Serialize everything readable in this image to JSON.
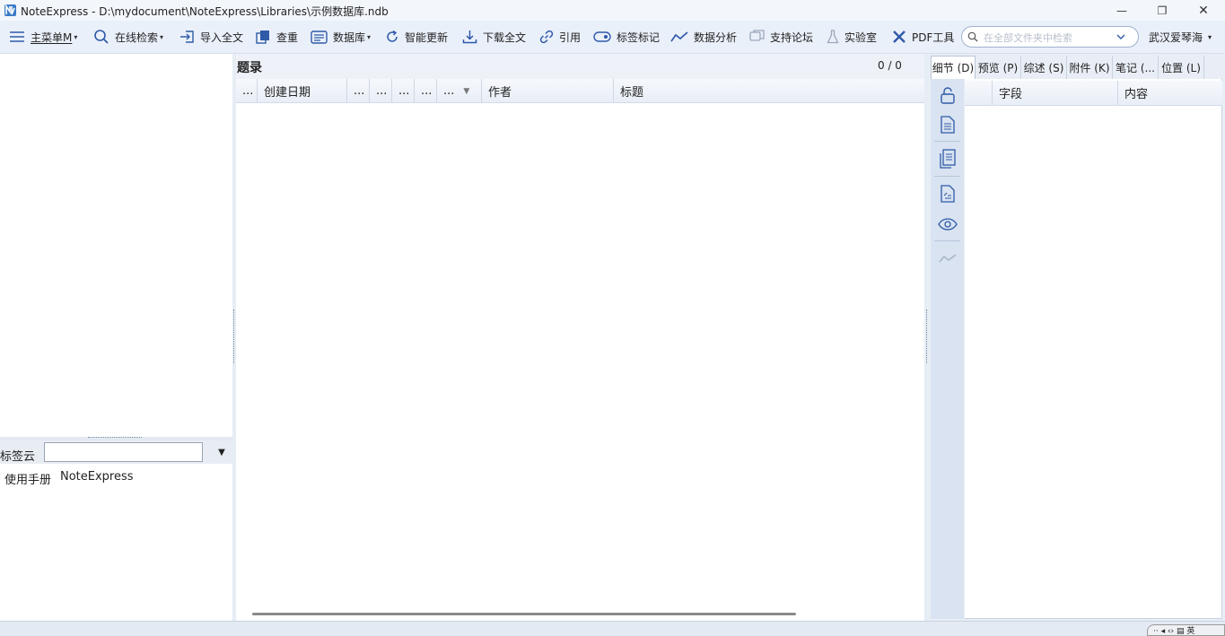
{
  "window": {
    "title": "NoteExpress - D:\\mydocument\\NoteExpress\\Libraries\\示例数据库.ndb",
    "minimize_glyph": "—",
    "maximize_glyph": "❐",
    "close_glyph": "✕"
  },
  "toolbar": {
    "main_menu": "主菜单M",
    "online_search": "在线检索",
    "import_fulltext": "导入全文",
    "dedupe": "查重",
    "database": "数据库",
    "smart_update": "智能更新",
    "download_fulltext": "下载全文",
    "cite": "引用",
    "tag_mark": "标签标记",
    "data_analysis": "数据分析",
    "support_forum": "支持论坛",
    "lab": "实验室",
    "pdf_tools": "PDF工具",
    "search_placeholder": "在全部文件夹中检索",
    "user_name": "武汉爱琴海",
    "dropdown_caret": "▾"
  },
  "left_pane": {
    "tagcloud_label": "标签云",
    "tagcloud_value": "",
    "tagcloud_arrow": "▼",
    "tags": [
      "使用手册",
      "NoteExpress"
    ]
  },
  "records": {
    "title": "题录",
    "count": "0 / 0",
    "columns": [
      "...",
      "创建日期",
      "...",
      "...",
      "...",
      "...",
      "...",
      "作者",
      "标题"
    ],
    "sort_indicator": "▼"
  },
  "detail_pane": {
    "tabs": [
      "细节 (D)",
      "预览 (P)",
      "综述 (S)",
      "附件 (K)",
      "笔记 (...",
      "位置 (L)"
    ],
    "active_tab": 0,
    "columns": [
      "字段",
      "内容"
    ]
  },
  "statusbar": {
    "tray_text": "·· ◂ ‹› ▤ 英"
  },
  "colors": {
    "accent": "#2f5aa8",
    "toolbar_bg": "#eaf0fa",
    "pane_bg": "#ffffff"
  }
}
